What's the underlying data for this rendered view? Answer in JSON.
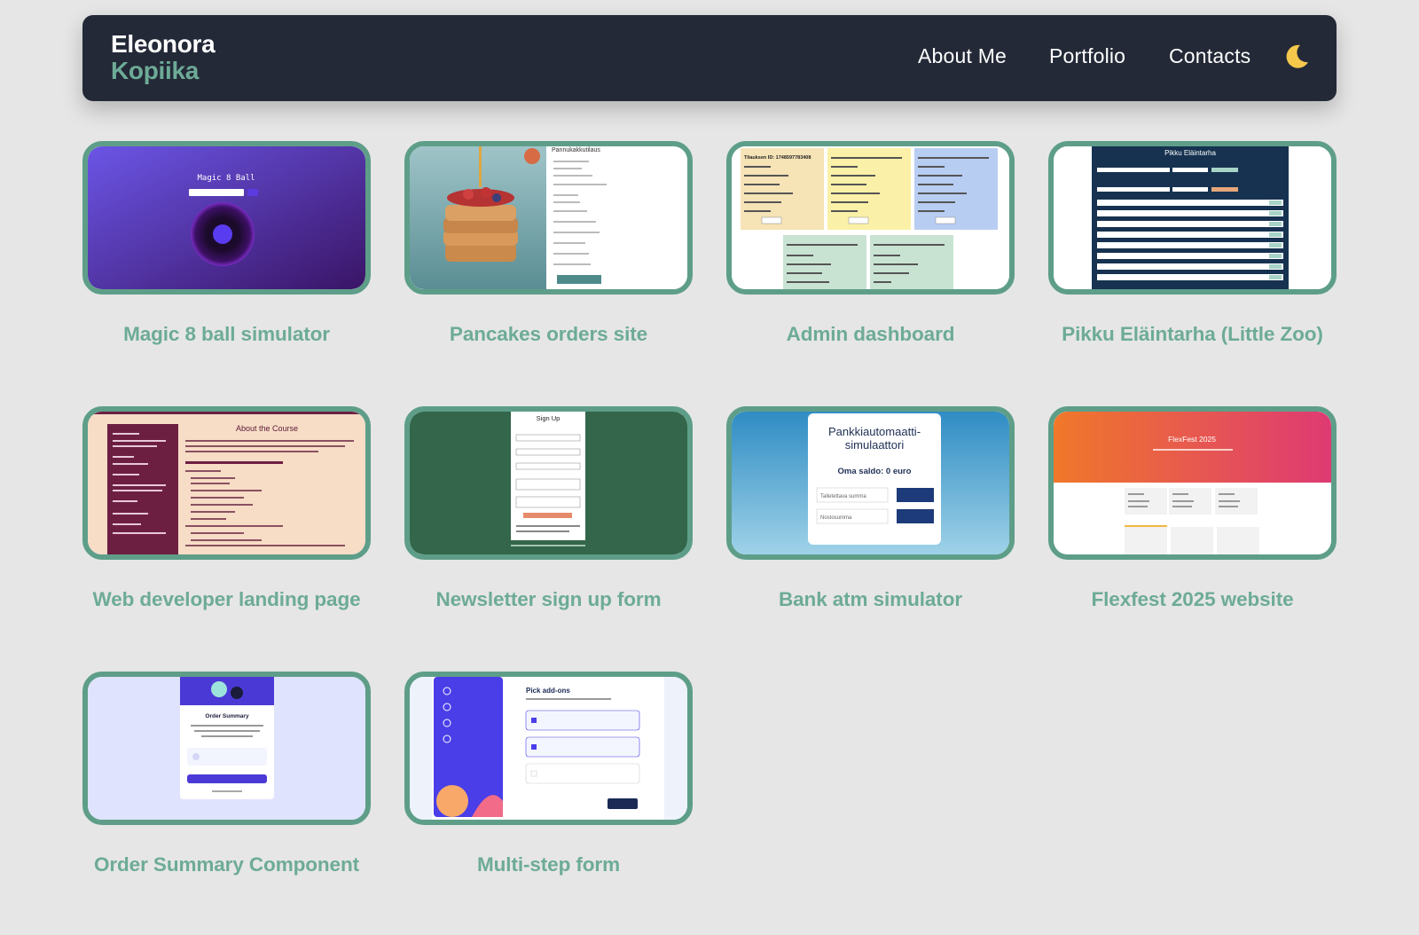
{
  "header": {
    "brand_first": "Eleonora",
    "brand_last": "Kopiika",
    "nav": {
      "about": "About Me",
      "portfolio": "Portfolio",
      "contacts": "Contacts"
    },
    "theme_icon": "moon-icon"
  },
  "colors": {
    "background": "#e6e6e6",
    "navbar": "#232937",
    "accent": "#6dab97",
    "card_border": "#5e9e89",
    "moon": "#f5c84c"
  },
  "projects": [
    {
      "title": "Magic 8 ball simulator",
      "thumb": {
        "heading": "Magic 8 Ball"
      }
    },
    {
      "title": "Pancakes orders site",
      "thumb": {
        "heading": "Pannukakkutilaus"
      }
    },
    {
      "title": "Admin dashboard",
      "thumb": {
        "order_label": "Tilauksen ID: 1748597783408"
      }
    },
    {
      "title": "Pikku Eläintarha (Little Zoo)",
      "thumb": {
        "heading": "Pikku Eläintarha"
      }
    },
    {
      "title": "Web developer landing page",
      "thumb": {
        "heading": "About the Course"
      }
    },
    {
      "title": "Newsletter sign up form",
      "thumb": {
        "heading": "Sign Up"
      }
    },
    {
      "title": "Bank atm simulator",
      "thumb": {
        "heading_1": "Pankkiautomaatti-",
        "heading_2": "simulaattori",
        "balance": "Oma saldo: 0 euro",
        "deposit_label": "Talletettava summa",
        "withdraw_label": "Nostosumma"
      }
    },
    {
      "title": "Flexfest 2025 website",
      "thumb": {
        "heading": "FlexFest 2025"
      }
    },
    {
      "title": "Order Summary Component",
      "thumb": {
        "heading": "Order Summary"
      }
    },
    {
      "title": "Multi-step form",
      "thumb": {
        "heading": "Pick add-ons"
      }
    }
  ]
}
